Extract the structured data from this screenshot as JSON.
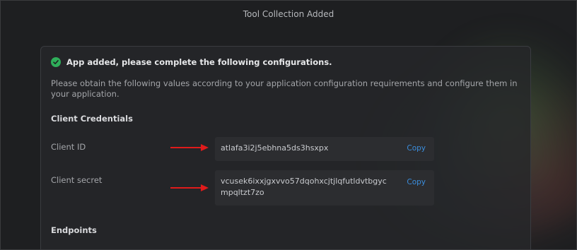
{
  "dialog": {
    "title": "Tool Collection Added"
  },
  "banner": {
    "message": "App added, please complete the following configurations.",
    "status_color": "#2fae5a"
  },
  "description": "Please obtain the following values according to your application configuration requirements and configure them in your application.",
  "credentials": {
    "heading": "Client Credentials",
    "client_id": {
      "label": "Client ID",
      "value": "atlafa3i2j5ebhna5ds3hsxpx",
      "copy_label": "Copy"
    },
    "client_secret": {
      "label": "Client secret",
      "value": "vcusek6ixxjgxvvo57dqohxcjtjlqfutldvtbgycmpqltzt7zo",
      "copy_label": "Copy"
    }
  },
  "endpoints": {
    "heading": "Endpoints"
  },
  "colors": {
    "accent": "#3b8ede",
    "arrow": "#e01b1b"
  }
}
